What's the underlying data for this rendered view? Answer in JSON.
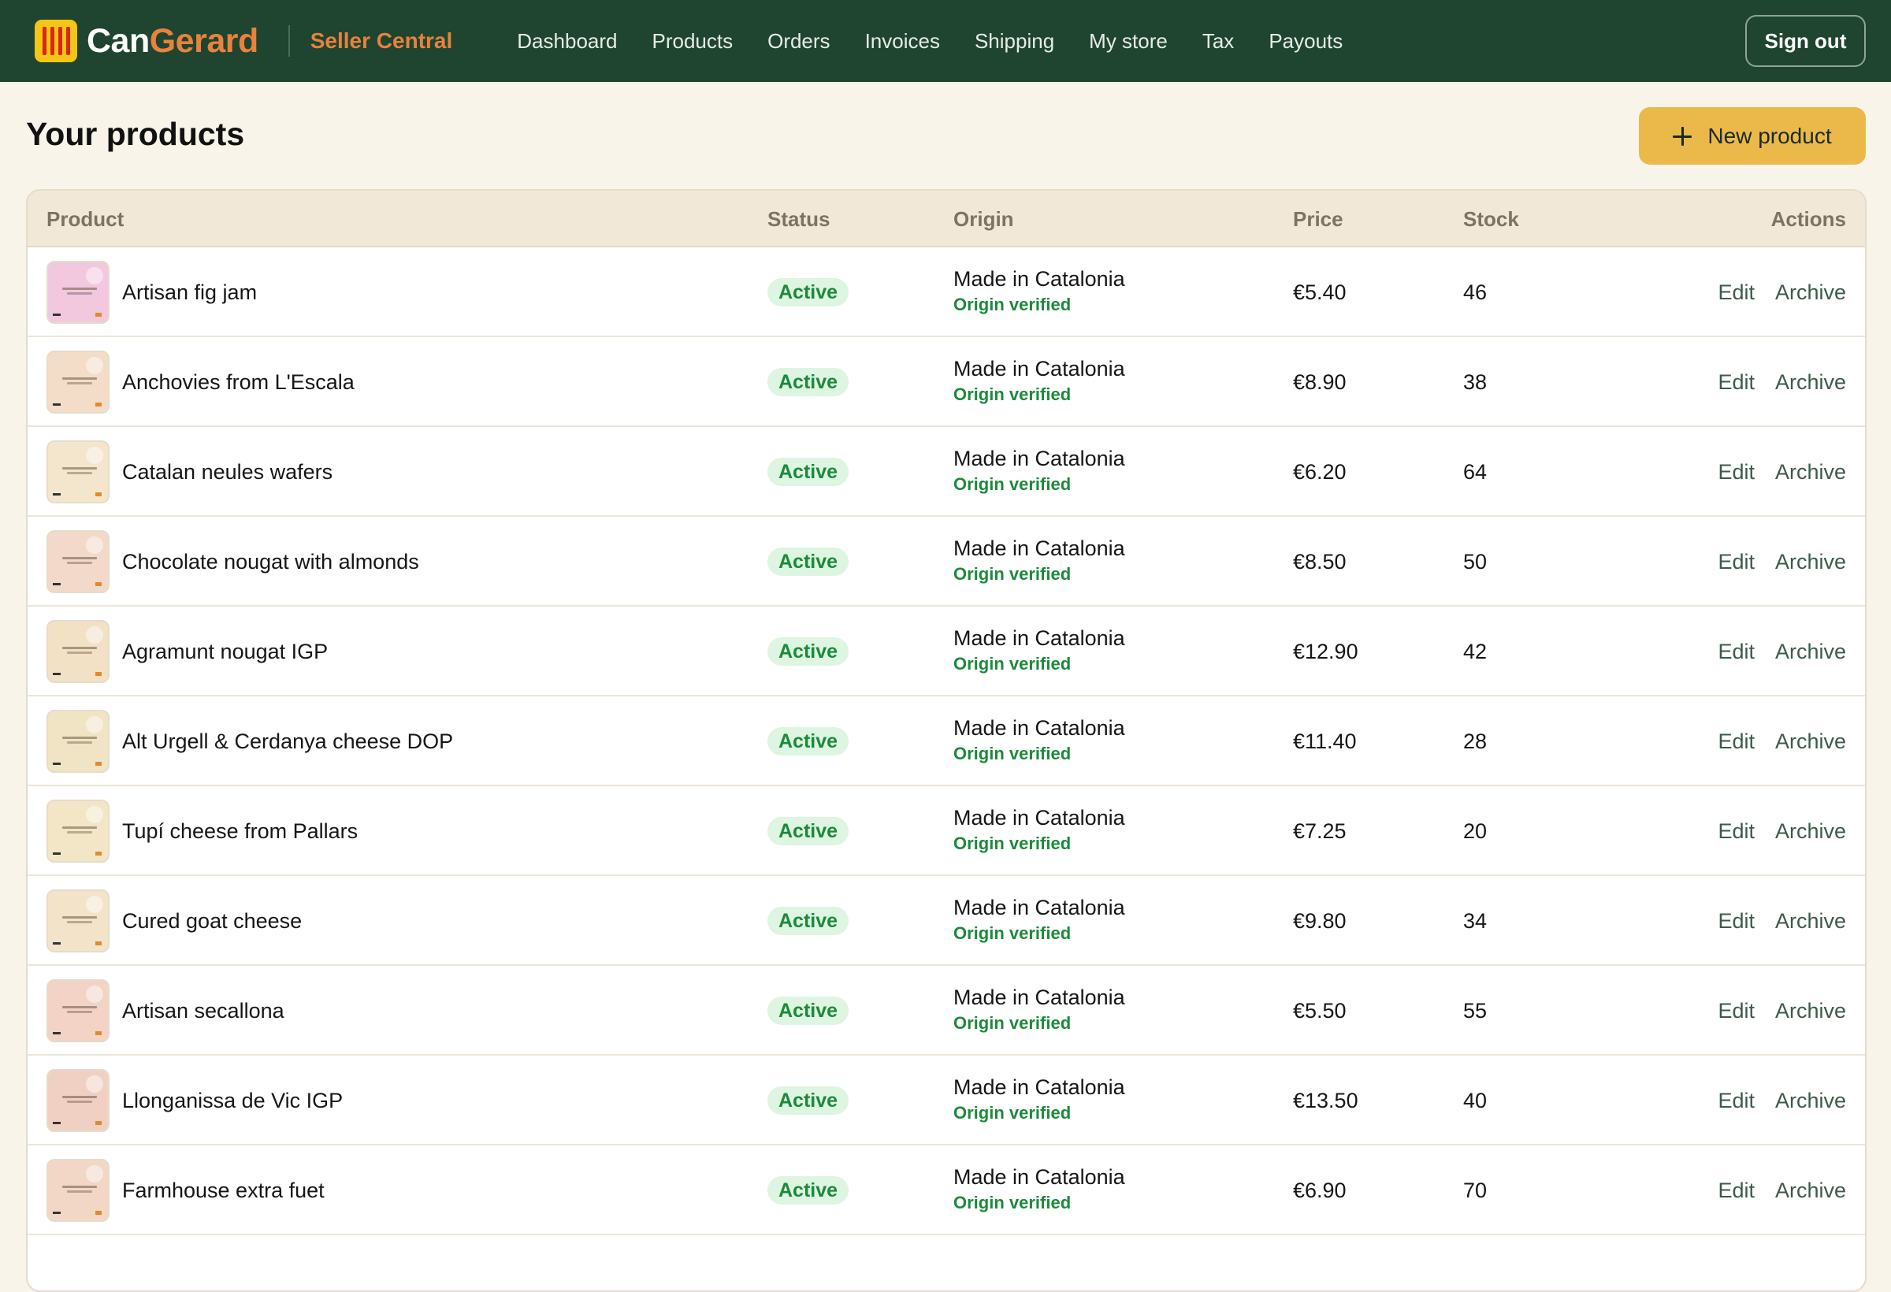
{
  "brand": {
    "name_part1": "Can",
    "name_part2": "Gerard",
    "section": "Seller Central"
  },
  "nav": {
    "items": [
      "Dashboard",
      "Products",
      "Orders",
      "Invoices",
      "Shipping",
      "My store",
      "Tax",
      "Payouts"
    ],
    "sign_out": "Sign out"
  },
  "page": {
    "title": "Your products",
    "new_product_label": "New product"
  },
  "table": {
    "headers": {
      "product": "Product",
      "status": "Status",
      "origin": "Origin",
      "price": "Price",
      "stock": "Stock",
      "actions": "Actions"
    },
    "rows": [
      {
        "name": "Artisan fig jam",
        "status": "Active",
        "origin": "Made in Catalonia",
        "origin_note": "Origin verified",
        "price": "€5.40",
        "stock": "46",
        "edit": "Edit",
        "archive": "Archive",
        "thumb_color": "#f2c8df"
      },
      {
        "name": "Anchovies from L'Escala",
        "status": "Active",
        "origin": "Made in Catalonia",
        "origin_note": "Origin verified",
        "price": "€8.90",
        "stock": "38",
        "edit": "Edit",
        "archive": "Archive",
        "thumb_color": "#f3dcc8"
      },
      {
        "name": "Catalan neules wafers",
        "status": "Active",
        "origin": "Made in Catalonia",
        "origin_note": "Origin verified",
        "price": "€6.20",
        "stock": "64",
        "edit": "Edit",
        "archive": "Archive",
        "thumb_color": "#f3e6cd"
      },
      {
        "name": "Chocolate nougat with almonds",
        "status": "Active",
        "origin": "Made in Catalonia",
        "origin_note": "Origin verified",
        "price": "€8.50",
        "stock": "50",
        "edit": "Edit",
        "archive": "Archive",
        "thumb_color": "#f2d9c9"
      },
      {
        "name": "Agramunt nougat IGP",
        "status": "Active",
        "origin": "Made in Catalonia",
        "origin_note": "Origin verified",
        "price": "€12.90",
        "stock": "42",
        "edit": "Edit",
        "archive": "Archive",
        "thumb_color": "#f3e1c6"
      },
      {
        "name": "Alt Urgell & Cerdanya cheese DOP",
        "status": "Active",
        "origin": "Made in Catalonia",
        "origin_note": "Origin verified",
        "price": "€11.40",
        "stock": "28",
        "edit": "Edit",
        "archive": "Archive",
        "thumb_color": "#f1e4c5"
      },
      {
        "name": "Tupí cheese from Pallars",
        "status": "Active",
        "origin": "Made in Catalonia",
        "origin_note": "Origin verified",
        "price": "€7.25",
        "stock": "20",
        "edit": "Edit",
        "archive": "Archive",
        "thumb_color": "#f2e6c7"
      },
      {
        "name": "Cured goat cheese",
        "status": "Active",
        "origin": "Made in Catalonia",
        "origin_note": "Origin verified",
        "price": "€9.80",
        "stock": "34",
        "edit": "Edit",
        "archive": "Archive",
        "thumb_color": "#f2e3c9"
      },
      {
        "name": "Artisan secallona",
        "status": "Active",
        "origin": "Made in Catalonia",
        "origin_note": "Origin verified",
        "price": "€5.50",
        "stock": "55",
        "edit": "Edit",
        "archive": "Archive",
        "thumb_color": "#f2d3c6"
      },
      {
        "name": "Llonganissa de Vic IGP",
        "status": "Active",
        "origin": "Made in Catalonia",
        "origin_note": "Origin verified",
        "price": "€13.50",
        "stock": "40",
        "edit": "Edit",
        "archive": "Archive",
        "thumb_color": "#f1d0c4"
      },
      {
        "name": "Farmhouse extra fuet",
        "status": "Active",
        "origin": "Made in Catalonia",
        "origin_note": "Origin verified",
        "price": "€6.90",
        "stock": "70",
        "edit": "Edit",
        "archive": "Archive",
        "thumb_color": "#f2d7c6"
      }
    ]
  }
}
